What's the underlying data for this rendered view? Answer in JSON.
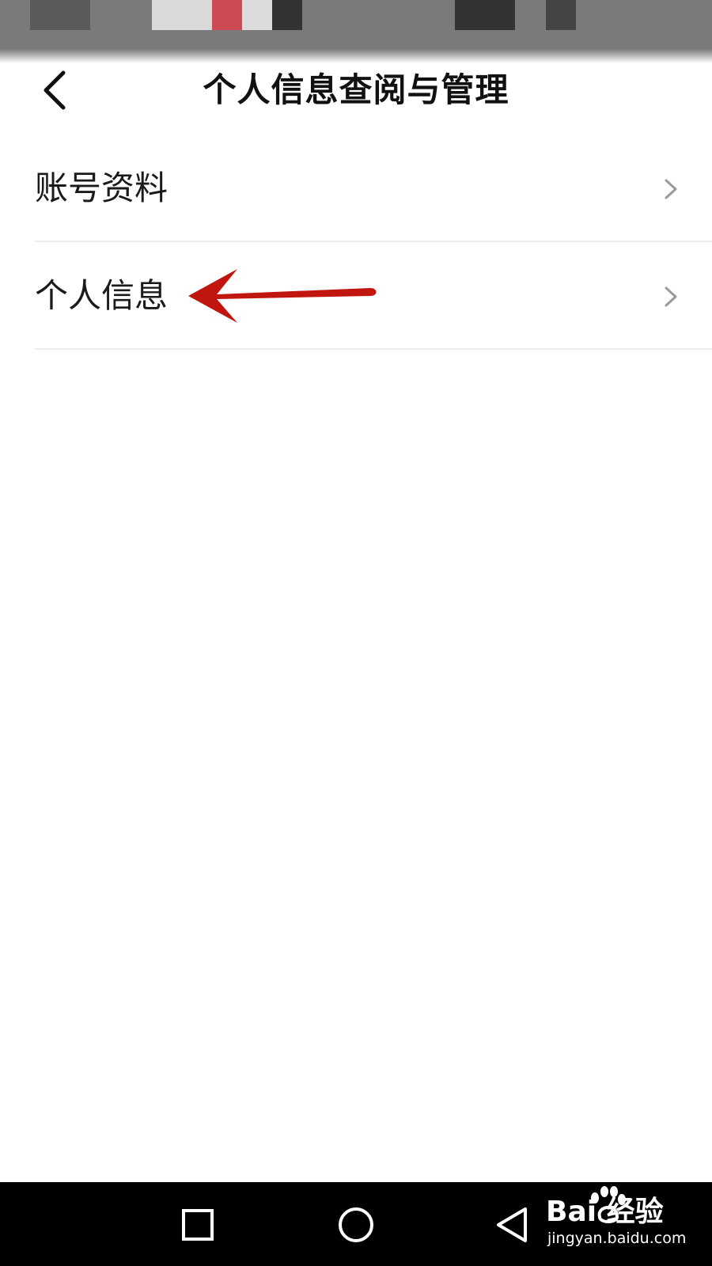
{
  "header": {
    "title": "个人信息查阅与管理"
  },
  "menu": {
    "items": [
      {
        "label": "账号资料"
      },
      {
        "label": "个人信息"
      }
    ]
  },
  "watermark": {
    "logo": "Bai  经验",
    "url": "jingyan.baidu.com"
  },
  "colors": {
    "annotation_arrow": "#c0160f",
    "chevron": "#9a9a9a",
    "divider": "#ededed",
    "nav_bar": "#000000"
  },
  "icons": {
    "back": "chevron-left-icon",
    "row_chevron": "chevron-right-icon",
    "nav_recent": "square-icon",
    "nav_home": "circle-icon",
    "nav_back": "triangle-back-icon"
  }
}
